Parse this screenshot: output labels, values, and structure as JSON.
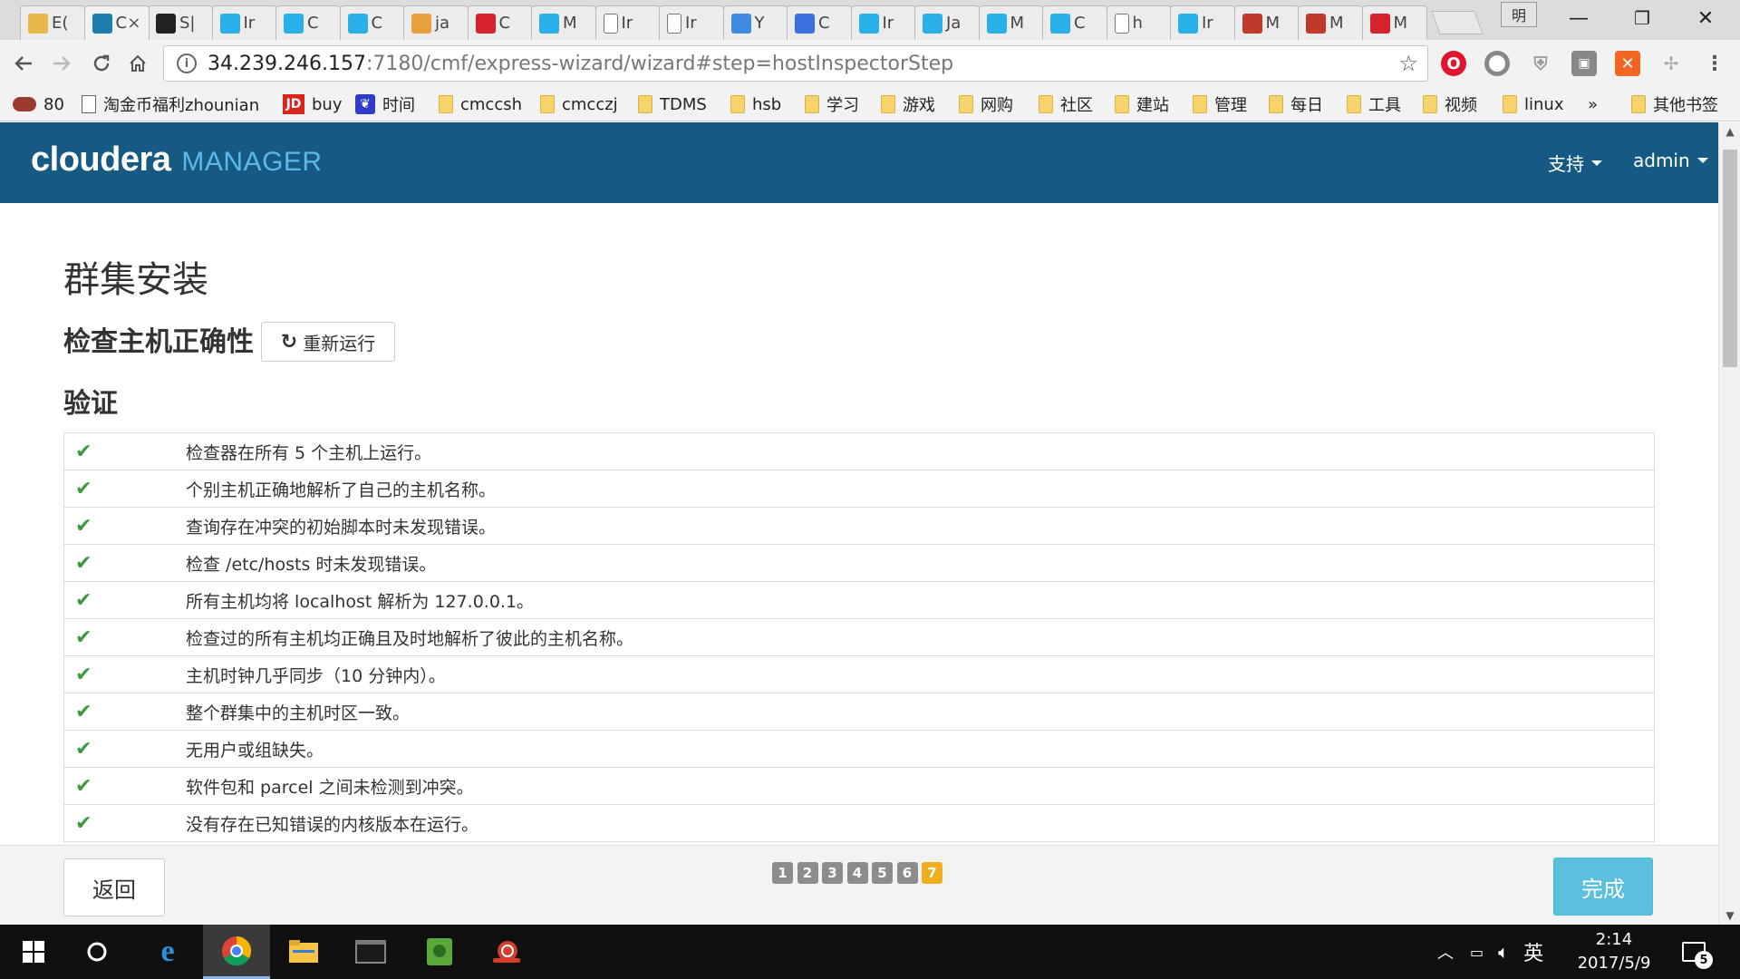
{
  "browser": {
    "tabs": [
      {
        "label": "E(",
        "icon": "package-icon",
        "color": "#e8b74a"
      },
      {
        "label": "C",
        "icon": "cloudera-c-icon",
        "color": "#1c7fb0",
        "active": true
      },
      {
        "label": "S|",
        "icon": "github-icon",
        "color": "#222222"
      },
      {
        "label": "Ir",
        "icon": "cloudera-c-icon",
        "color": "#2ab0e8"
      },
      {
        "label": "C",
        "icon": "cloudera-c-icon",
        "color": "#2ab0e8"
      },
      {
        "label": "C",
        "icon": "cloudera-c-icon",
        "color": "#2ab0e8"
      },
      {
        "label": "ja",
        "icon": "java-icon",
        "color": "#e7a03b"
      },
      {
        "label": "C",
        "icon": "csdn-c-icon",
        "color": "#d6222a"
      },
      {
        "label": "M",
        "icon": "cloudera-c-icon",
        "color": "#2ab0e8"
      },
      {
        "label": "Ir",
        "icon": "page-icon",
        "color": "#ffffff"
      },
      {
        "label": "Ir",
        "icon": "page-icon",
        "color": "#ffffff"
      },
      {
        "label": "Y",
        "icon": "translate-icon",
        "color": "#3d8ae0"
      },
      {
        "label": "C",
        "icon": "gear-circle-icon",
        "color": "#3d6fe0"
      },
      {
        "label": "Ir",
        "icon": "cloudera-c-icon",
        "color": "#2ab0e8"
      },
      {
        "label": "Ja",
        "icon": "cloudera-c-icon",
        "color": "#2ab0e8"
      },
      {
        "label": "M",
        "icon": "cloudera-c-icon",
        "color": "#2ab0e8"
      },
      {
        "label": "C",
        "icon": "cloudera-c-icon",
        "color": "#2ab0e8"
      },
      {
        "label": "h",
        "icon": "page-icon",
        "color": "#ffffff"
      },
      {
        "label": "Ir",
        "icon": "cloudera-c-icon",
        "color": "#2ab0e8"
      },
      {
        "label": "M",
        "icon": "b-logo-icon",
        "color": "#c0392b"
      },
      {
        "label": "M",
        "icon": "b-logo-icon",
        "color": "#c0392b"
      },
      {
        "label": "M",
        "icon": "csdn-c-icon",
        "color": "#d6222a"
      }
    ],
    "close_glyph": "×",
    "profile_label": "明",
    "window_controls": {
      "minimize": "—",
      "restore": "❐",
      "close": "✕"
    },
    "url": {
      "host": "34.239.246.157",
      "path": ":7180/cmf/express-wizard/wizard#step=hostInspectorStep"
    },
    "bookmarks": [
      {
        "label": "80",
        "icon": "bean"
      },
      {
        "label": "淘金币福利zhounian",
        "icon": "page"
      },
      {
        "label": "buy",
        "icon": "jd"
      },
      {
        "label": "时间",
        "icon": "paw"
      },
      {
        "label": "cmccsh",
        "icon": "folder"
      },
      {
        "label": "cmcczj",
        "icon": "folder"
      },
      {
        "label": "TDMS",
        "icon": "folder"
      },
      {
        "label": "hsb",
        "icon": "folder"
      },
      {
        "label": "学习",
        "icon": "folder"
      },
      {
        "label": "游戏",
        "icon": "folder"
      },
      {
        "label": "网购",
        "icon": "folder"
      },
      {
        "label": "社区",
        "icon": "folder"
      },
      {
        "label": "建站",
        "icon": "folder"
      },
      {
        "label": "管理",
        "icon": "folder"
      },
      {
        "label": "每日",
        "icon": "folder"
      },
      {
        "label": "工具",
        "icon": "folder"
      },
      {
        "label": "视频",
        "icon": "folder"
      },
      {
        "label": "linux",
        "icon": "folder"
      }
    ],
    "bookmarks_overflow": "»",
    "other_bookmarks": "其他书签"
  },
  "app": {
    "brand": "cloudera",
    "product": "MANAGER",
    "menu_support": "支持",
    "menu_user": "admin",
    "colors": {
      "header": "#165a84",
      "accent": "#5bb8e8",
      "success": "#3c9a3c",
      "step_current": "#f0ad1e",
      "primary_button": "#5bc0de"
    }
  },
  "page": {
    "title": "群集安装",
    "subtitle": "检查主机正确性",
    "rerun_label": "重新运行",
    "section_title": "验证",
    "checks": [
      "检查器在所有 5 个主机上运行。",
      "个别主机正确地解析了自己的主机名称。",
      "查询存在冲突的初始脚本时未发现错误。",
      "检查 /etc/hosts 时未发现错误。",
      "所有主机均将 localhost 解析为 127.0.0.1。",
      "检查过的所有主机均正确且及时地解析了彼此的主机名称。",
      "主机时钟几乎同步（10 分钟内）。",
      "整个群集中的主机时区一致。",
      "无用户或组缺失。",
      "软件包和 parcel 之间未检测到冲突。",
      "没有存在已知错误的内核版本在运行。"
    ]
  },
  "footer": {
    "back_label": "返回",
    "finish_label": "完成",
    "steps": [
      "1",
      "2",
      "3",
      "4",
      "5",
      "6",
      "7"
    ],
    "current_step": "7"
  },
  "taskbar": {
    "ime": "英",
    "time": "2:14",
    "date": "2017/5/9",
    "notification_count": "5"
  }
}
